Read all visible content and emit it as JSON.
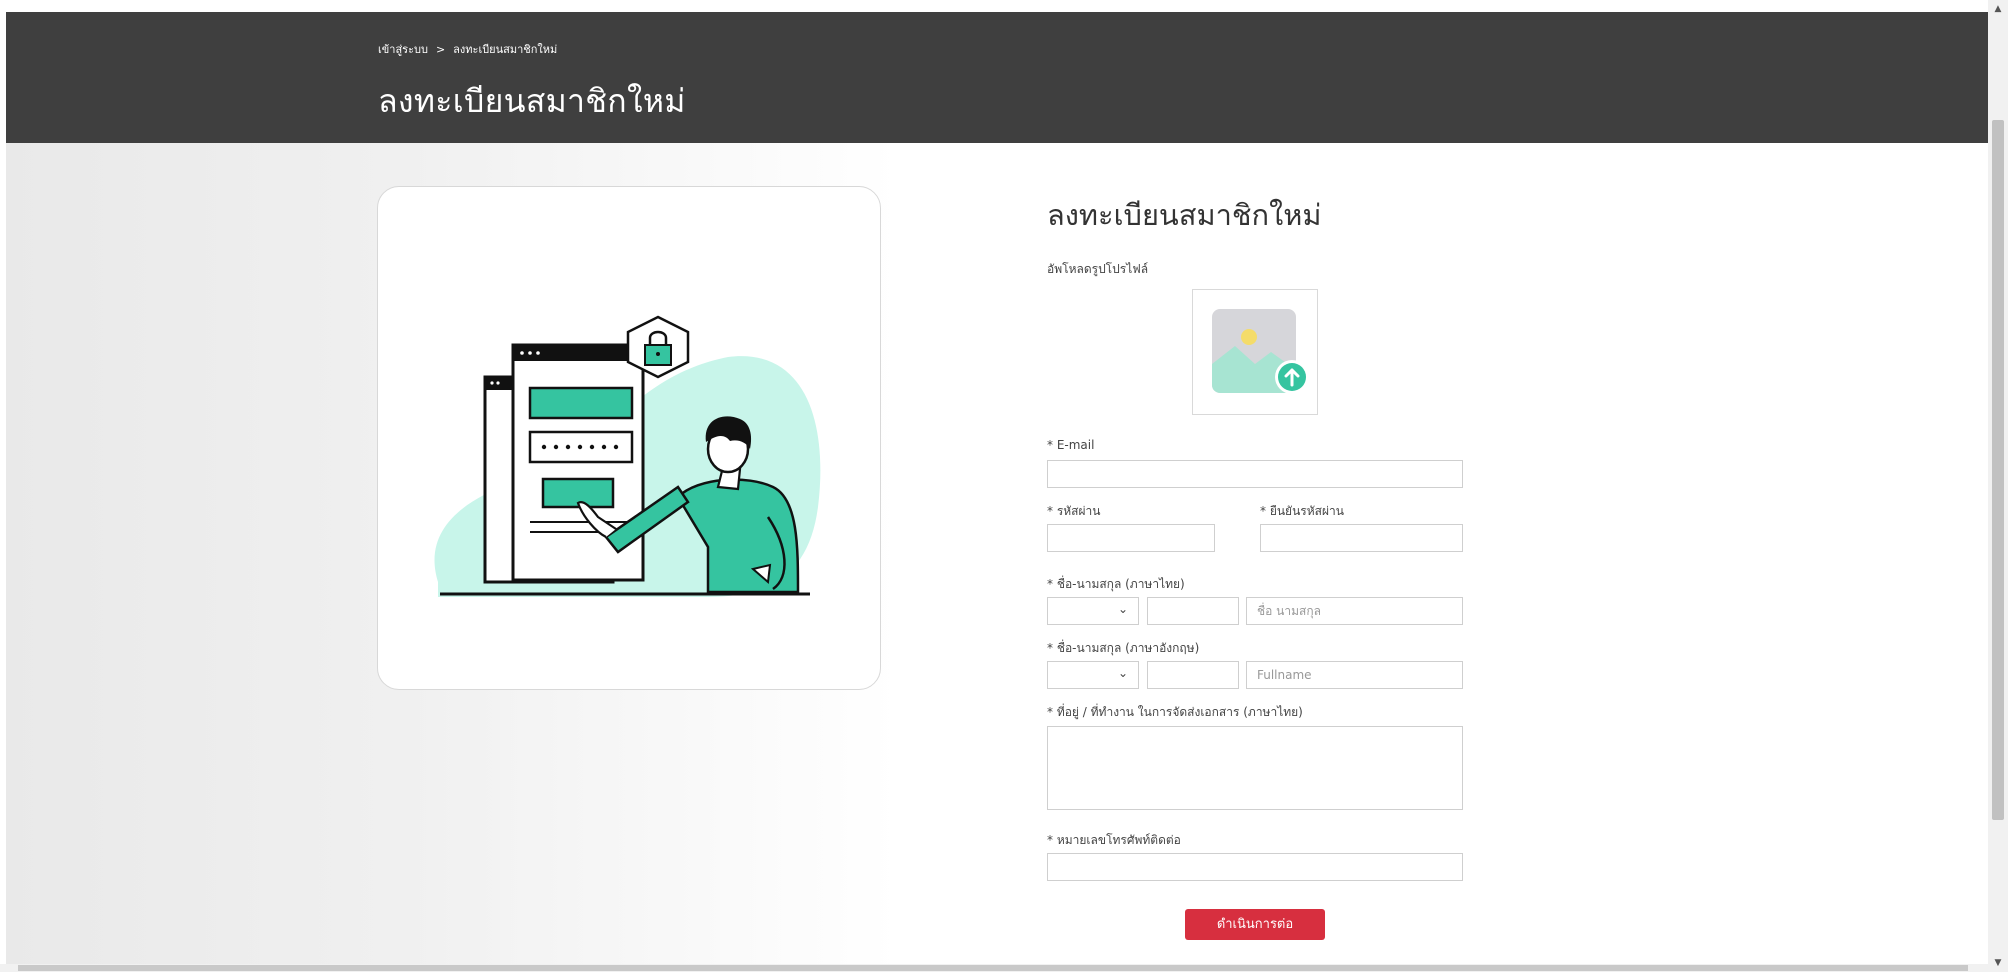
{
  "breadcrumb": {
    "home": "เข้าสู่ระบบ",
    "separator": ">",
    "current": "ลงทะเบียนสมาชิกใหม่"
  },
  "header": {
    "title": "ลงทะเบียนสมาชิกใหม่"
  },
  "form": {
    "title": "ลงทะเบียนสมาชิกใหม่",
    "upload_label": "อัพโหลดรูปโปรไฟล์",
    "email_label": "* E-mail",
    "password_label": "* รหัสผ่าน",
    "confirm_password_label": "* ยืนยันรหัสผ่าน",
    "name_th_label": "* ชื่อ-นามสกุล (ภาษาไทย)",
    "name_th_placeholder": "ชื่อ นามสกุล",
    "name_en_label": "* ชื่อ-นามสกุล (ภาษาอังกฤษ)",
    "name_en_placeholder": "Fullname",
    "address_label": "* ที่อยู่ / ที่ทำงาน ในการจัดส่งเอกสาร (ภาษาไทย)",
    "phone_label": "* หมายเลขโทรศัพท์ติดต่อ",
    "submit_label": "ดำเนินการต่อ"
  },
  "icons": {
    "select_chevron": "chevron-down-icon",
    "upload": "image-upload-icon"
  },
  "colors": {
    "header_bg": "#3f3f3f",
    "accent": "#35c4a0",
    "submit_bg": "#d72f3f"
  }
}
